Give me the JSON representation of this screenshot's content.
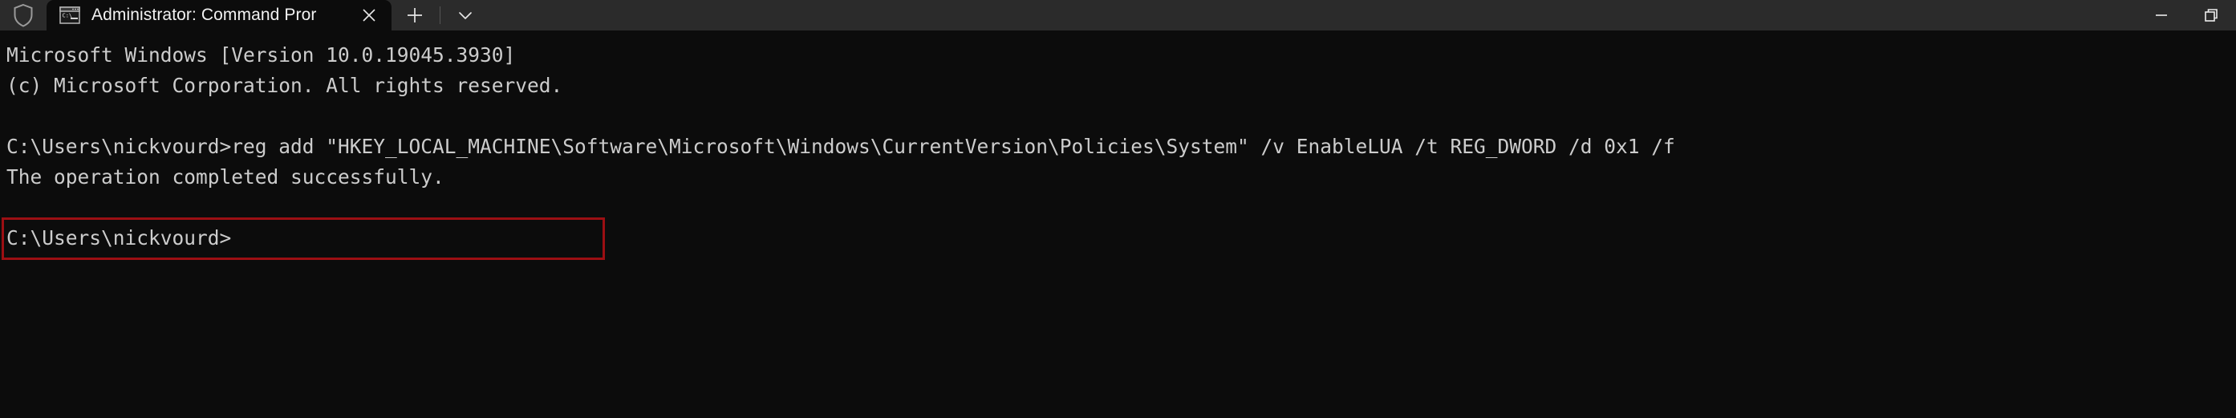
{
  "window": {
    "titlebar": {
      "shield_icon": "shield-icon",
      "minimize_label": "Minimize",
      "maximize_label": "Restore Down",
      "close_label": "Close"
    },
    "tabs": [
      {
        "icon": "command-prompt-icon",
        "title": "Administrator: Command Pror",
        "close_label": "Close tab",
        "active": true
      }
    ],
    "new_tab_button": {
      "icon": "plus-icon",
      "label": "New tab"
    },
    "dropdown_button": {
      "icon": "chevron-down-icon",
      "label": "Open new tab dropdown"
    }
  },
  "terminal": {
    "lines": [
      "Microsoft Windows [Version 10.0.19045.3930]",
      "(c) Microsoft Corporation. All rights reserved.",
      "",
      "C:\\Users\\nickvourd>reg add \"HKEY_LOCAL_MACHINE\\Software\\Microsoft\\Windows\\CurrentVersion\\Policies\\System\" /v EnableLUA /t REG_DWORD /d 0x1 /f",
      "The operation completed successfully.",
      "",
      "C:\\Users\\nickvourd>"
    ],
    "prompt": "C:\\Users\\nickvourd>",
    "command": "reg add \"HKEY_LOCAL_MACHINE\\Software\\Microsoft\\Windows\\CurrentVersion\\Policies\\System\" /v EnableLUA /t REG_DWORD /d 0x1 /f",
    "result": "The operation completed successfully."
  },
  "annotation": {
    "type": "rectangle-highlight",
    "target_text": "The operation completed successfully.",
    "color": "#9c0f13"
  },
  "colors": {
    "titlebar_bg": "#2b2b2b",
    "terminal_bg": "#0c0c0c",
    "terminal_fg": "#cccccc",
    "tab_title_fg": "#f2f2f2",
    "annotation": "#9c0f13"
  }
}
